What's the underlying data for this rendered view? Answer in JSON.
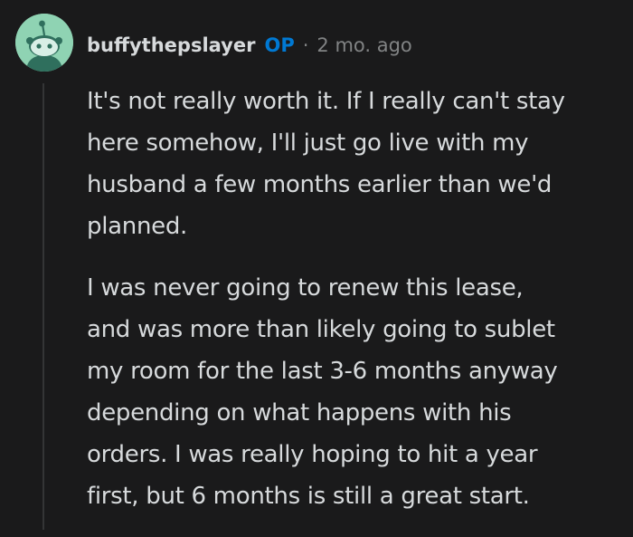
{
  "comment": {
    "author": "buffythepslayer",
    "badge": "OP",
    "separator": "·",
    "time_ago": "2 mo. ago",
    "avatar_icon": "reddit-snoo-avatar-icon",
    "paragraphs": [
      {
        "lines": [
          "It's not really worth it. If I really can't stay",
          "here somehow, I'll just go live with my",
          "husband a few months earlier than we'd",
          "planned."
        ]
      },
      {
        "lines": [
          "I was never going to renew this lease,",
          "and was more than likely going to sublet",
          "my room for the last 3-6 months anyway",
          "depending on what happens with his",
          "orders. I was really hoping to hit a year",
          "first, but 6 months is still a great start."
        ]
      }
    ]
  },
  "colors": {
    "background": "#1a1a1b",
    "text": "#d7dadc",
    "meta": "#818384",
    "op_badge": "#0079d3",
    "avatar_bg": "#8fd3b3",
    "thread_line": "#343536"
  }
}
